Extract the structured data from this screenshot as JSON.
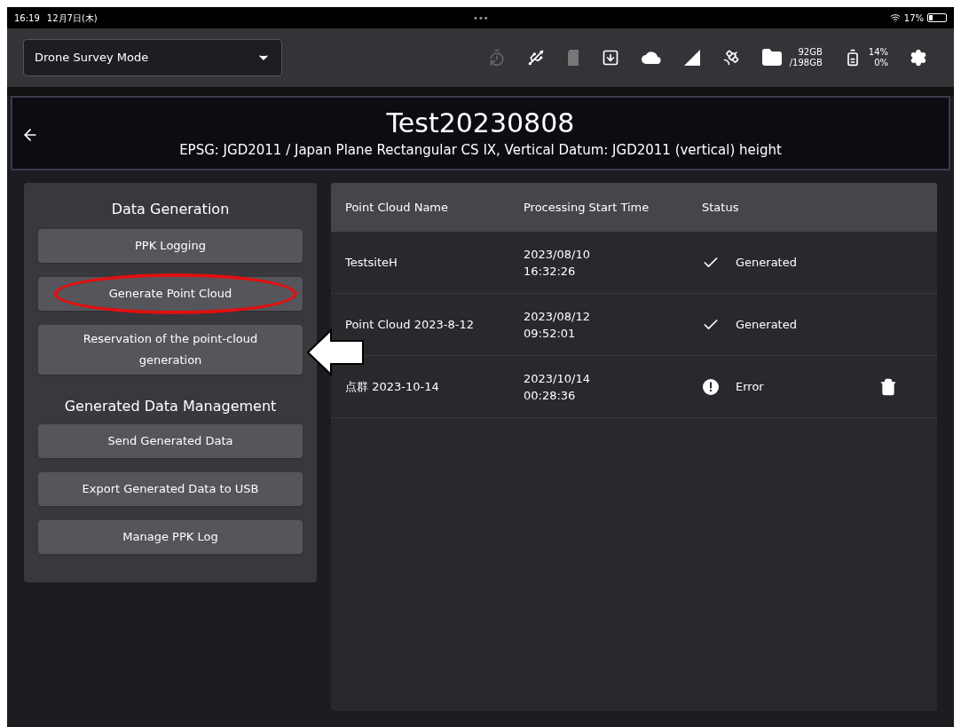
{
  "status_bar": {
    "time": "16:19",
    "date": "12月7日(木)",
    "dots": "•••",
    "battery": "17%"
  },
  "toolbar": {
    "mode": "Drone Survey Mode",
    "storage": {
      "used": "92GB",
      "total": "/198GB"
    },
    "power": {
      "battery": "14%",
      "charge": "0%"
    }
  },
  "header": {
    "title": "Test20230808",
    "subtitle": "EPSG: JGD2011 / Japan Plane Rectangular CS IX, Vertical Datum: JGD2011 (vertical) height"
  },
  "sidebar": {
    "sections": [
      {
        "title": "Data Generation",
        "buttons": [
          {
            "label": "PPK Logging",
            "circled": false,
            "pointed": false
          },
          {
            "label": "Generate Point Cloud",
            "circled": true,
            "pointed": false
          },
          {
            "label": "Reservation of the point-cloud generation",
            "circled": false,
            "pointed": true
          }
        ]
      },
      {
        "title": "Generated Data Management",
        "buttons": [
          {
            "label": "Send Generated Data",
            "circled": false,
            "pointed": false
          },
          {
            "label": "Export Generated Data to USB",
            "circled": false,
            "pointed": false
          },
          {
            "label": "Manage PPK Log",
            "circled": false,
            "pointed": false
          }
        ]
      }
    ]
  },
  "table": {
    "columns": [
      "Point Cloud Name",
      "Processing Start Time",
      "Status"
    ],
    "rows": [
      {
        "name": "TestsiteH",
        "date": "2023/08/10",
        "time": "16:32:26",
        "status": "Generated",
        "kind": "generated",
        "deletable": false
      },
      {
        "name": "Point Cloud 2023-8-12",
        "date": "2023/08/12",
        "time": "09:52:01",
        "status": "Generated",
        "kind": "generated",
        "deletable": false
      },
      {
        "name": "点群 2023-10-14",
        "date": "2023/10/14",
        "time": "00:28:36",
        "status": "Error",
        "kind": "error",
        "deletable": true
      }
    ]
  }
}
